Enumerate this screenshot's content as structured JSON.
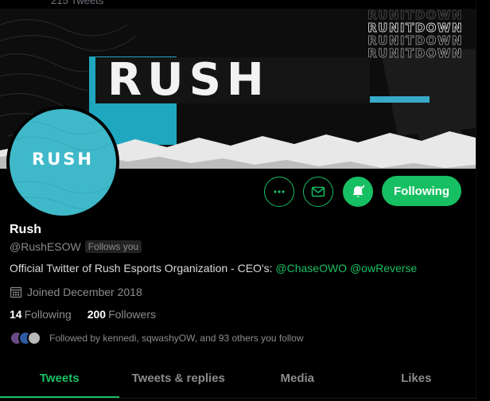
{
  "header": {
    "tweet_count": "215 Tweets"
  },
  "banner": {
    "word": "RUSH",
    "tagline_lines": [
      "RUNITDOWN",
      "RUNITDOWN",
      "RUNITDOWN",
      "RUNITDOWN"
    ],
    "accent_color": "#1fa7bf"
  },
  "avatar": {
    "word": "RUSH",
    "background": "#3fb9c9"
  },
  "actions": {
    "more_icon": "more-icon",
    "message_icon": "mail-icon",
    "notify_icon": "bell-icon",
    "following_label": "Following",
    "accent_color": "#17bf63"
  },
  "profile": {
    "name": "Rush",
    "handle": "@RushESOW",
    "follows_you": "Follows you",
    "bio_text": "Official Twitter of Rush Esports Organization - CEO's: ",
    "bio_mentions": [
      "@ChaseOWO",
      "@owReverse"
    ],
    "joined": "Joined December 2018",
    "following_count": "14",
    "following_label": "Following",
    "followers_count": "200",
    "followers_label": "Followers",
    "followed_by": "Followed by kennedi, sqwashyOW, and 93 others you follow"
  },
  "tabs": [
    {
      "label": "Tweets",
      "active": true
    },
    {
      "label": "Tweets & replies",
      "active": false
    },
    {
      "label": "Media",
      "active": false
    },
    {
      "label": "Likes",
      "active": false
    }
  ]
}
